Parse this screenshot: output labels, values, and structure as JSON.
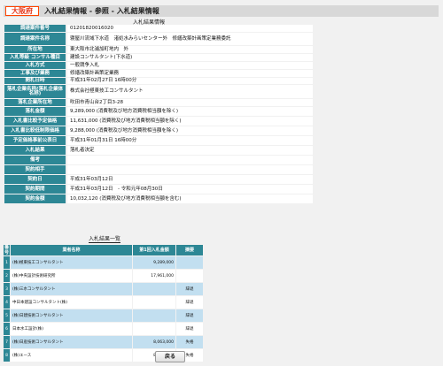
{
  "header": {
    "prefecture": "大阪府",
    "title": "入札結果情報 - 参照 - 入札結果情報"
  },
  "detail": {
    "section_title": "入札結果情報",
    "rows": [
      {
        "label": "調達案件番号",
        "value": "01201820016020"
      },
      {
        "label": "調達案件名称",
        "value": "寝屋川流域下水道　渚処水みらいセンター外　修繕改築計画策定業務委託"
      },
      {
        "label": "所在地",
        "value": "東大阪市北浦加町地内　外"
      },
      {
        "label": "入札等級 コンサル種目",
        "value": "建設コンサルタント(下水道)"
      },
      {
        "label": "入札方式",
        "value": "一般競争入札"
      },
      {
        "label": "工事及び業務",
        "value": "修繕改築計画策定業務"
      },
      {
        "label": "開札日時",
        "value": "平成31年02月27日 16時00分"
      },
      {
        "label": "落札企業名称(落札企業体名称)",
        "value": "株式会社極東技工コンサルタント"
      },
      {
        "label": "落札企業所在地",
        "value": "吹田市青山台2丁目3-28"
      },
      {
        "label": "落札金額",
        "value": "9,289,000 (消費税及び地方消費税相当額を除く)"
      },
      {
        "label": "入札書比較予定価格",
        "value": "11,631,000 (消費税及び地方消費税相当額を除く)"
      },
      {
        "label": "入札書比較低制限価格",
        "value": "9,288,000 (消費税及び地方消費税相当額を除く)"
      },
      {
        "label": "予定価格事前公表日",
        "value": "平成31年01月31日 16時00分"
      },
      {
        "label": "入札結果",
        "value": "落札者決定"
      },
      {
        "label": "備考",
        "value": ""
      },
      {
        "label": "契約相手",
        "value": ""
      },
      {
        "label": "契約日",
        "value": "平成31年03月12日"
      },
      {
        "label": "契約期間",
        "value": "平成31年03月12日　- 令和元年08月30日"
      },
      {
        "label": "契約金額",
        "value": "10,032,120 (消費税及び地方消費税相当額を含む)"
      }
    ]
  },
  "bid_list": {
    "section_title": "入札結果一覧",
    "columns": [
      "番号",
      "業者名称",
      "第1回入札金額",
      "摘要"
    ],
    "rows": [
      {
        "no": "1",
        "name": "(株)極東技工コンサルタント",
        "amount": "9,289,000",
        "remark": ""
      },
      {
        "no": "2",
        "name": "(株)中央設計技術研究所",
        "amount": "17,961,000",
        "remark": ""
      },
      {
        "no": "3",
        "name": "(株)三水コンサルタント",
        "amount": "",
        "remark": "辞退"
      },
      {
        "no": "4",
        "name": "中日本建設コンサルタント(株)",
        "amount": "",
        "remark": "辞退"
      },
      {
        "no": "5",
        "name": "(株)日建技術コンサルタント",
        "amount": "",
        "remark": "辞退"
      },
      {
        "no": "6",
        "name": "日本水工設計(株)",
        "amount": "",
        "remark": "辞退"
      },
      {
        "no": "7",
        "name": "(株)日産技術コンサルタント",
        "amount": "8,063,000",
        "remark": "失格"
      },
      {
        "no": "8",
        "name": "(株)エース",
        "amount": "8,111,000",
        "remark": "失格"
      }
    ]
  },
  "back_button": "戻る"
}
